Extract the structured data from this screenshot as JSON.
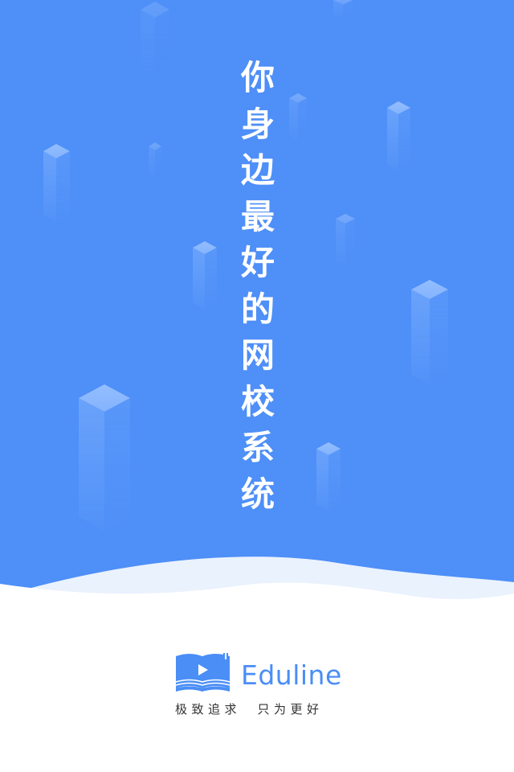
{
  "slogan": {
    "chars": [
      "你",
      "身",
      "边",
      "最",
      "好",
      "的",
      "网",
      "校",
      "系",
      "统"
    ]
  },
  "brand": {
    "name": "Eduline",
    "tagline": "极致追求  只为更好"
  },
  "colors": {
    "background_blue": "#4e8ff8",
    "wave_light": "#eaf2fe",
    "white": "#ffffff",
    "brand_blue": "#4a8ef6",
    "tagline_text": "#333333"
  },
  "icons": {
    "logo": "open-book-play-icon",
    "decor": "isometric-pillar-icon"
  }
}
